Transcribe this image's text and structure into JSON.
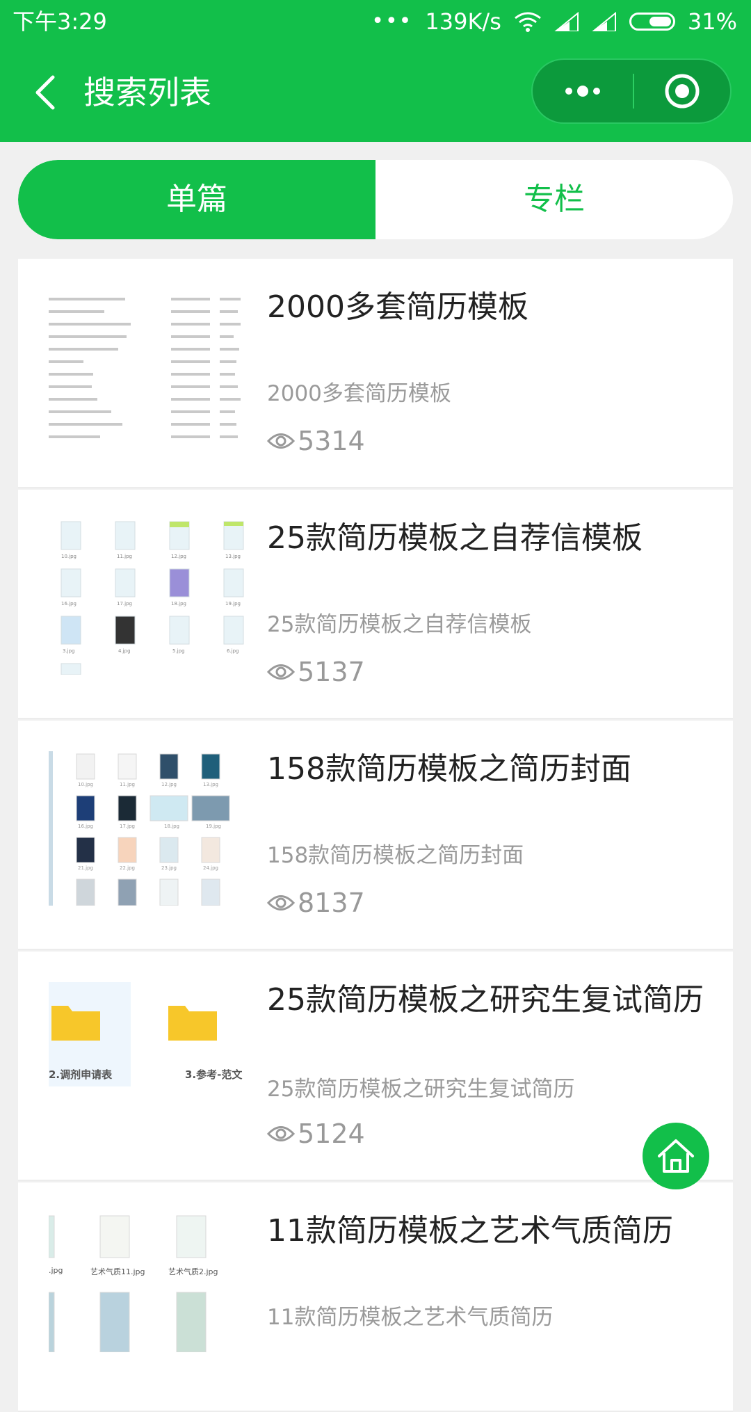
{
  "status_bar": {
    "time": "下午3:29",
    "more_dots": "•••",
    "network_speed": "139K/s",
    "battery_percent": "31%",
    "battery_level": 0.31
  },
  "header": {
    "title": "搜索列表",
    "back_icon": "chevron-left-icon",
    "more_icon": "more-dots-icon",
    "close_icon": "target-circle-icon"
  },
  "tabs": [
    {
      "label": "单篇",
      "active": true
    },
    {
      "label": "专栏",
      "active": false
    }
  ],
  "items": [
    {
      "title": "2000多套简历模板",
      "subtitle": "2000多套简历模板",
      "views": "5314"
    },
    {
      "title": "25款简历模板之自荐信模板",
      "subtitle": "25款简历模板之自荐信模板",
      "views": "5137"
    },
    {
      "title": "158款简历模板之简历封面",
      "subtitle": "158款简历模板之简历封面",
      "views": "8137"
    },
    {
      "title": "25款简历模板之研究生复试简历",
      "subtitle": "25款简历模板之研究生复试简历",
      "views": "5124",
      "folder_labels": [
        "2.调剂申请表",
        "3.参考-范文"
      ]
    },
    {
      "title": "11款简历模板之艺术气质简历",
      "subtitle": "11款简历模板之艺术气质简历",
      "views": "",
      "thumb_labels": [
        ".jpg",
        "艺术气质11.jpg",
        "艺术气质2.jpg"
      ]
    }
  ],
  "home_button": {
    "icon": "home-icon"
  },
  "colors": {
    "brand_green": "#12bf4a",
    "folder_yellow": "#f7c72a"
  }
}
